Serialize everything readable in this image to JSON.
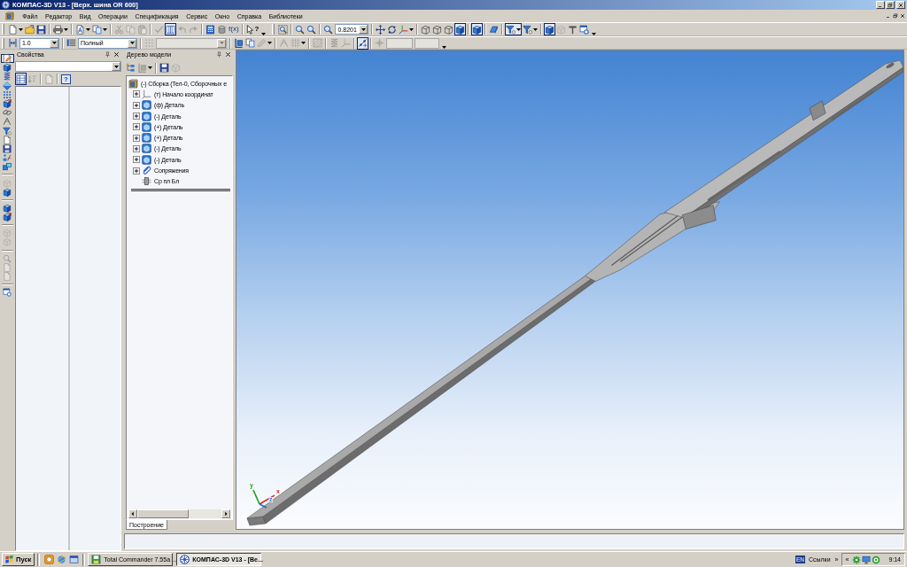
{
  "window": {
    "title": "КОМПАС-3D V13 - [Верх. шина OR 600]"
  },
  "menu": [
    "Файл",
    "Редактор",
    "Вид",
    "Операции",
    "Спецификация",
    "Сервис",
    "Окно",
    "Справка",
    "Библиотеки"
  ],
  "toolbar_rows": [
    [
      {
        "groups": [
          [
            {
              "kind": "new",
              "pressed": false,
              "disabled": false,
              "dropdown": true
            },
            {
              "kind": "open",
              "pressed": false,
              "disabled": false,
              "dropdown": false
            },
            {
              "kind": "save",
              "pressed": false,
              "disabled": false,
              "dropdown": false
            }
          ],
          [
            {
              "kind": "print",
              "pressed": false,
              "disabled": false,
              "dropdown": true
            }
          ],
          [
            {
              "kind": "preview",
              "pressed": false,
              "disabled": false,
              "dropdown": true
            },
            {
              "kind": "layout",
              "pressed": false,
              "disabled": false,
              "dropdown": true
            }
          ],
          [
            {
              "kind": "cut",
              "pressed": false,
              "disabled": true,
              "dropdown": false
            },
            {
              "kind": "copy",
              "pressed": false,
              "disabled": true,
              "dropdown": false
            },
            {
              "kind": "paste",
              "pressed": false,
              "disabled": true,
              "dropdown": false
            }
          ],
          [
            {
              "kind": "apply",
              "pressed": false,
              "disabled": true,
              "dropdown": false
            },
            {
              "kind": "columns",
              "pressed": true,
              "disabled": false,
              "dropdown": false
            },
            {
              "kind": "undo",
              "pressed": false,
              "disabled": true,
              "dropdown": false
            },
            {
              "kind": "redo",
              "pressed": false,
              "disabled": true,
              "dropdown": false
            }
          ],
          [
            {
              "kind": "variables",
              "pressed": false,
              "disabled": false,
              "dropdown": false
            },
            {
              "kind": "cylinder",
              "pressed": false,
              "disabled": false,
              "dropdown": false
            },
            {
              "kind": "formula",
              "label": "f(x)",
              "pressed": false,
              "disabled": false,
              "dropdown": false
            }
          ],
          [
            {
              "kind": "whats-this",
              "label": "?",
              "pressed": false,
              "disabled": false,
              "dropdown": false
            }
          ]
        ]
      },
      {
        "groups": [
          [
            {
              "kind": "zoom-window",
              "pressed": false,
              "disabled": false,
              "dropdown": false
            }
          ],
          [
            {
              "kind": "zoom-in",
              "pressed": false,
              "disabled": false,
              "dropdown": false
            },
            {
              "kind": "zoom-all",
              "pressed": false,
              "disabled": false,
              "dropdown": false
            }
          ],
          [
            {
              "kind": "zoom-scale",
              "pressed": false,
              "disabled": false,
              "dropdown": false
            },
            {
              "kind": "combo",
              "value": "0.8201",
              "disabled": false,
              "dropdown": true
            }
          ],
          [
            {
              "kind": "pan",
              "pressed": false,
              "disabled": false,
              "dropdown": false
            },
            {
              "kind": "rotate",
              "pressed": false,
              "disabled": false,
              "dropdown": false
            },
            {
              "kind": "orientation",
              "pressed": false,
              "disabled": false,
              "dropdown": true
            }
          ],
          [
            {
              "kind": "wireframe",
              "pressed": false,
              "disabled": false,
              "dropdown": false
            },
            {
              "kind": "hidden-lines",
              "pressed": false,
              "disabled": false,
              "dropdown": false
            },
            {
              "kind": "thin-lines",
              "pressed": false,
              "disabled": false,
              "dropdown": false
            },
            {
              "kind": "shaded",
              "pressed": true,
              "disabled": false,
              "dropdown": false
            }
          ],
          [
            {
              "kind": "shaded-edges",
              "pressed": true,
              "disabled": false,
              "dropdown": false
            }
          ],
          [
            {
              "kind": "perspective",
              "pressed": false,
              "disabled": false,
              "dropdown": false
            }
          ],
          [
            {
              "kind": "filter",
              "pressed": true,
              "disabled": false,
              "dropdown": true
            },
            {
              "kind": "filter-2",
              "pressed": false,
              "disabled": false,
              "dropdown": true
            }
          ],
          [
            {
              "kind": "select-body",
              "pressed": true,
              "disabled": false,
              "dropdown": false
            },
            {
              "kind": "box",
              "pressed": false,
              "disabled": true,
              "dropdown": false
            },
            {
              "kind": "t-square",
              "pressed": false,
              "disabled": false,
              "dropdown": false
            },
            {
              "kind": "refresh",
              "pressed": false,
              "disabled": false,
              "dropdown": false
            }
          ]
        ]
      }
    ],
    [
      {
        "groups": [
          [
            {
              "kind": "step",
              "pressed": false,
              "disabled": false,
              "dropdown": false
            },
            {
              "kind": "combo",
              "value": "1.0",
              "disabled": false,
              "dropdown": true
            }
          ],
          [
            {
              "kind": "style",
              "pressed": false,
              "disabled": false,
              "dropdown": false
            },
            {
              "kind": "combo",
              "value": "Полный",
              "disabled": false,
              "dropdown": true
            }
          ],
          [
            {
              "kind": "grid",
              "pressed": false,
              "disabled": true,
              "dropdown": false
            },
            {
              "kind": "combo",
              "disabled": true,
              "dropdown": true
            }
          ],
          [
            {
              "kind": "structure",
              "pressed": false,
              "disabled": false,
              "dropdown": false
            },
            {
              "kind": "copy-part",
              "pressed": false,
              "disabled": false,
              "dropdown": false
            },
            {
              "kind": "pencil",
              "pressed": false,
              "disabled": true,
              "dropdown": true
            }
          ],
          [
            {
              "kind": "angle",
              "pressed": false,
              "disabled": true,
              "dropdown": false
            },
            {
              "kind": "grid-lines",
              "pressed": false,
              "disabled": true,
              "dropdown": true
            }
          ],
          [
            {
              "kind": "hatch",
              "pressed": false,
              "disabled": true,
              "dropdown": false
            }
          ],
          [
            {
              "kind": "spiral",
              "pressed": false,
              "disabled": true,
              "dropdown": false
            },
            {
              "kind": "orientation",
              "pressed": false,
              "disabled": true,
              "dropdown": false
            }
          ],
          [
            {
              "kind": "snap",
              "pressed": true,
              "disabled": false,
              "dropdown": false
            }
          ],
          [
            {
              "kind": "point",
              "pressed": false,
              "disabled": true,
              "dropdown": false
            },
            {
              "kind": "field",
              "disabled": true,
              "dropdown": false
            },
            {
              "kind": "field",
              "disabled": true,
              "dropdown": false
            }
          ]
        ]
      }
    ]
  ],
  "tool_strip": [
    [
      {
        "kind": "sketch",
        "pressed": true,
        "disabled": false,
        "dropdown": false
      },
      {
        "kind": "extrude",
        "pressed": false,
        "disabled": false,
        "dropdown": false
      },
      {
        "kind": "spiral",
        "pressed": false,
        "disabled": false,
        "dropdown": false
      },
      {
        "kind": "diamond",
        "pressed": false,
        "disabled": false,
        "dropdown": false
      },
      {
        "kind": "array",
        "pressed": false,
        "disabled": false,
        "dropdown": false
      },
      {
        "kind": "cube-arrow",
        "pressed": false,
        "disabled": false,
        "dropdown": false
      },
      {
        "kind": "chain",
        "pressed": false,
        "disabled": false,
        "dropdown": false
      },
      {
        "kind": "angle",
        "pressed": false,
        "disabled": false,
        "dropdown": false
      },
      {
        "kind": "filter",
        "pressed": false,
        "disabled": false,
        "dropdown": false
      },
      {
        "kind": "page",
        "pressed": false,
        "disabled": false,
        "dropdown": false
      },
      {
        "kind": "save",
        "pressed": false,
        "disabled": false,
        "dropdown": false
      },
      {
        "kind": "measure",
        "pressed": false,
        "disabled": false,
        "dropdown": false
      },
      {
        "kind": "parts",
        "pressed": false,
        "disabled": false,
        "dropdown": false
      }
    ],
    [
      {
        "kind": "box",
        "pressed": false,
        "disabled": true,
        "dropdown": false
      },
      {
        "kind": "extrude",
        "pressed": false,
        "disabled": false,
        "dropdown": false
      }
    ],
    [
      {
        "kind": "extrude",
        "pressed": false,
        "disabled": false,
        "dropdown": false
      },
      {
        "kind": "cube-arrow",
        "pressed": false,
        "disabled": false,
        "dropdown": false
      }
    ],
    [
      {
        "kind": "box",
        "pressed": false,
        "disabled": true,
        "dropdown": false
      },
      {
        "kind": "box",
        "pressed": false,
        "disabled": true,
        "dropdown": false
      }
    ],
    [
      {
        "kind": "zoom-in",
        "pressed": false,
        "disabled": true,
        "dropdown": false
      },
      {
        "kind": "page",
        "pressed": false,
        "disabled": true,
        "dropdown": false
      },
      {
        "kind": "page",
        "pressed": false,
        "disabled": true,
        "dropdown": false
      }
    ],
    [
      {
        "kind": "refresh",
        "pressed": false,
        "disabled": false,
        "dropdown": false
      }
    ]
  ],
  "properties_panel": {
    "title": "Свойства",
    "toolbar": [
      [
        {
          "kind": "table",
          "pressed": true,
          "disabled": false,
          "dropdown": false
        },
        {
          "kind": "sort",
          "pressed": false,
          "disabled": true,
          "dropdown": false
        }
      ],
      [
        {
          "kind": "page",
          "pressed": false,
          "disabled": true,
          "dropdown": false
        }
      ],
      [
        {
          "kind": "help",
          "label": "?",
          "pressed": false,
          "disabled": false,
          "dropdown": false
        }
      ]
    ]
  },
  "model_tree": {
    "title": "Дерево модели",
    "toolbar": [
      [
        {
          "kind": "tree",
          "pressed": false,
          "disabled": false,
          "dropdown": false
        },
        {
          "kind": "structure",
          "pressed": false,
          "disabled": true,
          "dropdown": true
        }
      ],
      [
        {
          "kind": "save",
          "pressed": false,
          "disabled": false,
          "dropdown": false
        },
        {
          "kind": "box",
          "pressed": false,
          "disabled": true,
          "dropdown": false
        }
      ]
    ],
    "items": [
      {
        "kind": "assembly",
        "label": "(-) Сборка (Тел-0, Сборочных е",
        "children": [
          {
            "kind": "origin",
            "label": "(т) Начало координат",
            "expanded": false
          },
          {
            "kind": "part",
            "label": "(ф) Деталь",
            "expanded": false
          },
          {
            "kind": "part",
            "label": "(-) Деталь",
            "expanded": false
          },
          {
            "kind": "part",
            "label": "(+) Деталь",
            "expanded": false
          },
          {
            "kind": "part",
            "label": "(+) Деталь",
            "expanded": false
          },
          {
            "kind": "part",
            "label": "(-) Деталь",
            "expanded": false
          },
          {
            "kind": "part",
            "label": "(-) Деталь",
            "expanded": false
          },
          {
            "kind": "mates",
            "label": "Сопряжения",
            "expanded": false
          },
          {
            "kind": "plane",
            "label": "Ср пл Бл"
          }
        ]
      }
    ],
    "tabs": [
      {
        "label": "Построение",
        "selected": true
      }
    ]
  },
  "viewport": {
    "axes": [
      {
        "label": "y",
        "color": "#1fa01f"
      },
      {
        "label": "x",
        "color": "#e02020"
      },
      {
        "label": "z",
        "color": "#1a6ad8"
      }
    ]
  },
  "taskbar": {
    "start": "Пуск",
    "quick_launch": [
      {
        "kind": "disc"
      },
      {
        "kind": "globe"
      },
      {
        "kind": "window"
      }
    ],
    "tasks": [
      {
        "kind": "commander",
        "label": "Total Commander 7.55a ...",
        "selected": false
      },
      {
        "kind": "kompas",
        "label": "КОМПАС-3D V13 - [Ве...",
        "selected": true
      }
    ],
    "language": "EN",
    "links": "Ссылки",
    "links_more": "»",
    "tray_expand": "«",
    "tray_icons": [
      {
        "kind": "gear"
      },
      {
        "kind": "monitor"
      },
      {
        "kind": "ring"
      }
    ],
    "clock": "9:14"
  }
}
